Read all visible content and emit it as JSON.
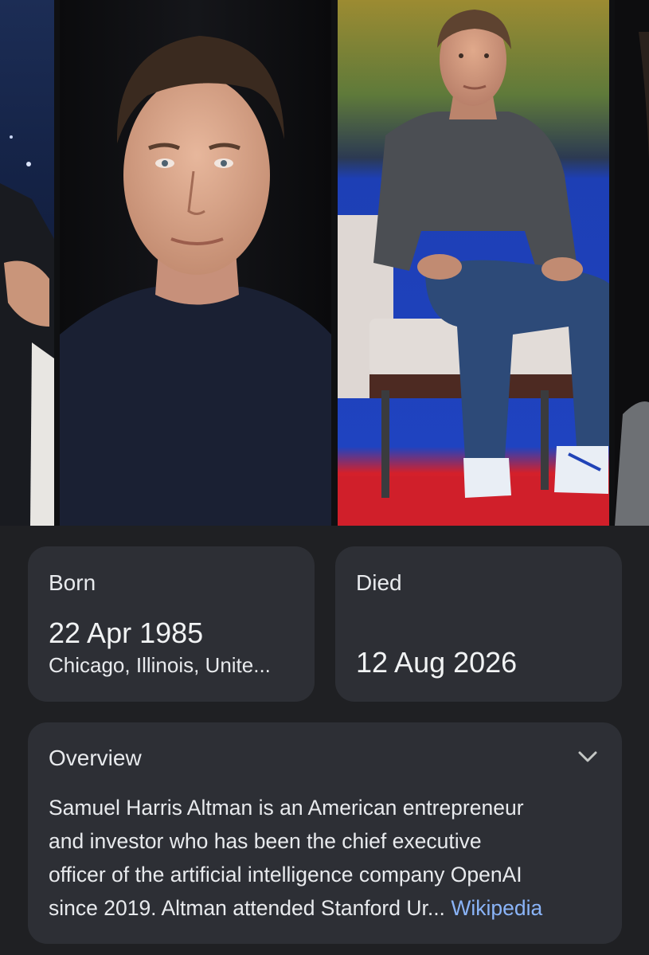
{
  "born": {
    "label": "Born",
    "date": "22 Apr 1985",
    "place": "Chicago, Illinois, Unite..."
  },
  "died": {
    "label": "Died",
    "date": "12 Aug 2026"
  },
  "overview": {
    "title": "Overview",
    "lines": [
      "Samuel Harris Altman is an American entrepreneur",
      "and investor who has been the chief executive",
      "officer of the artificial intelligence company OpenAI",
      "since 2019. Altman attended Stanford Ur..."
    ],
    "source_link": "Wikipedia",
    "expand_icon": "chevron-down-icon"
  },
  "colors": {
    "background": "#1f2023",
    "card": "#2d2f35",
    "link": "#8ab4f8"
  }
}
